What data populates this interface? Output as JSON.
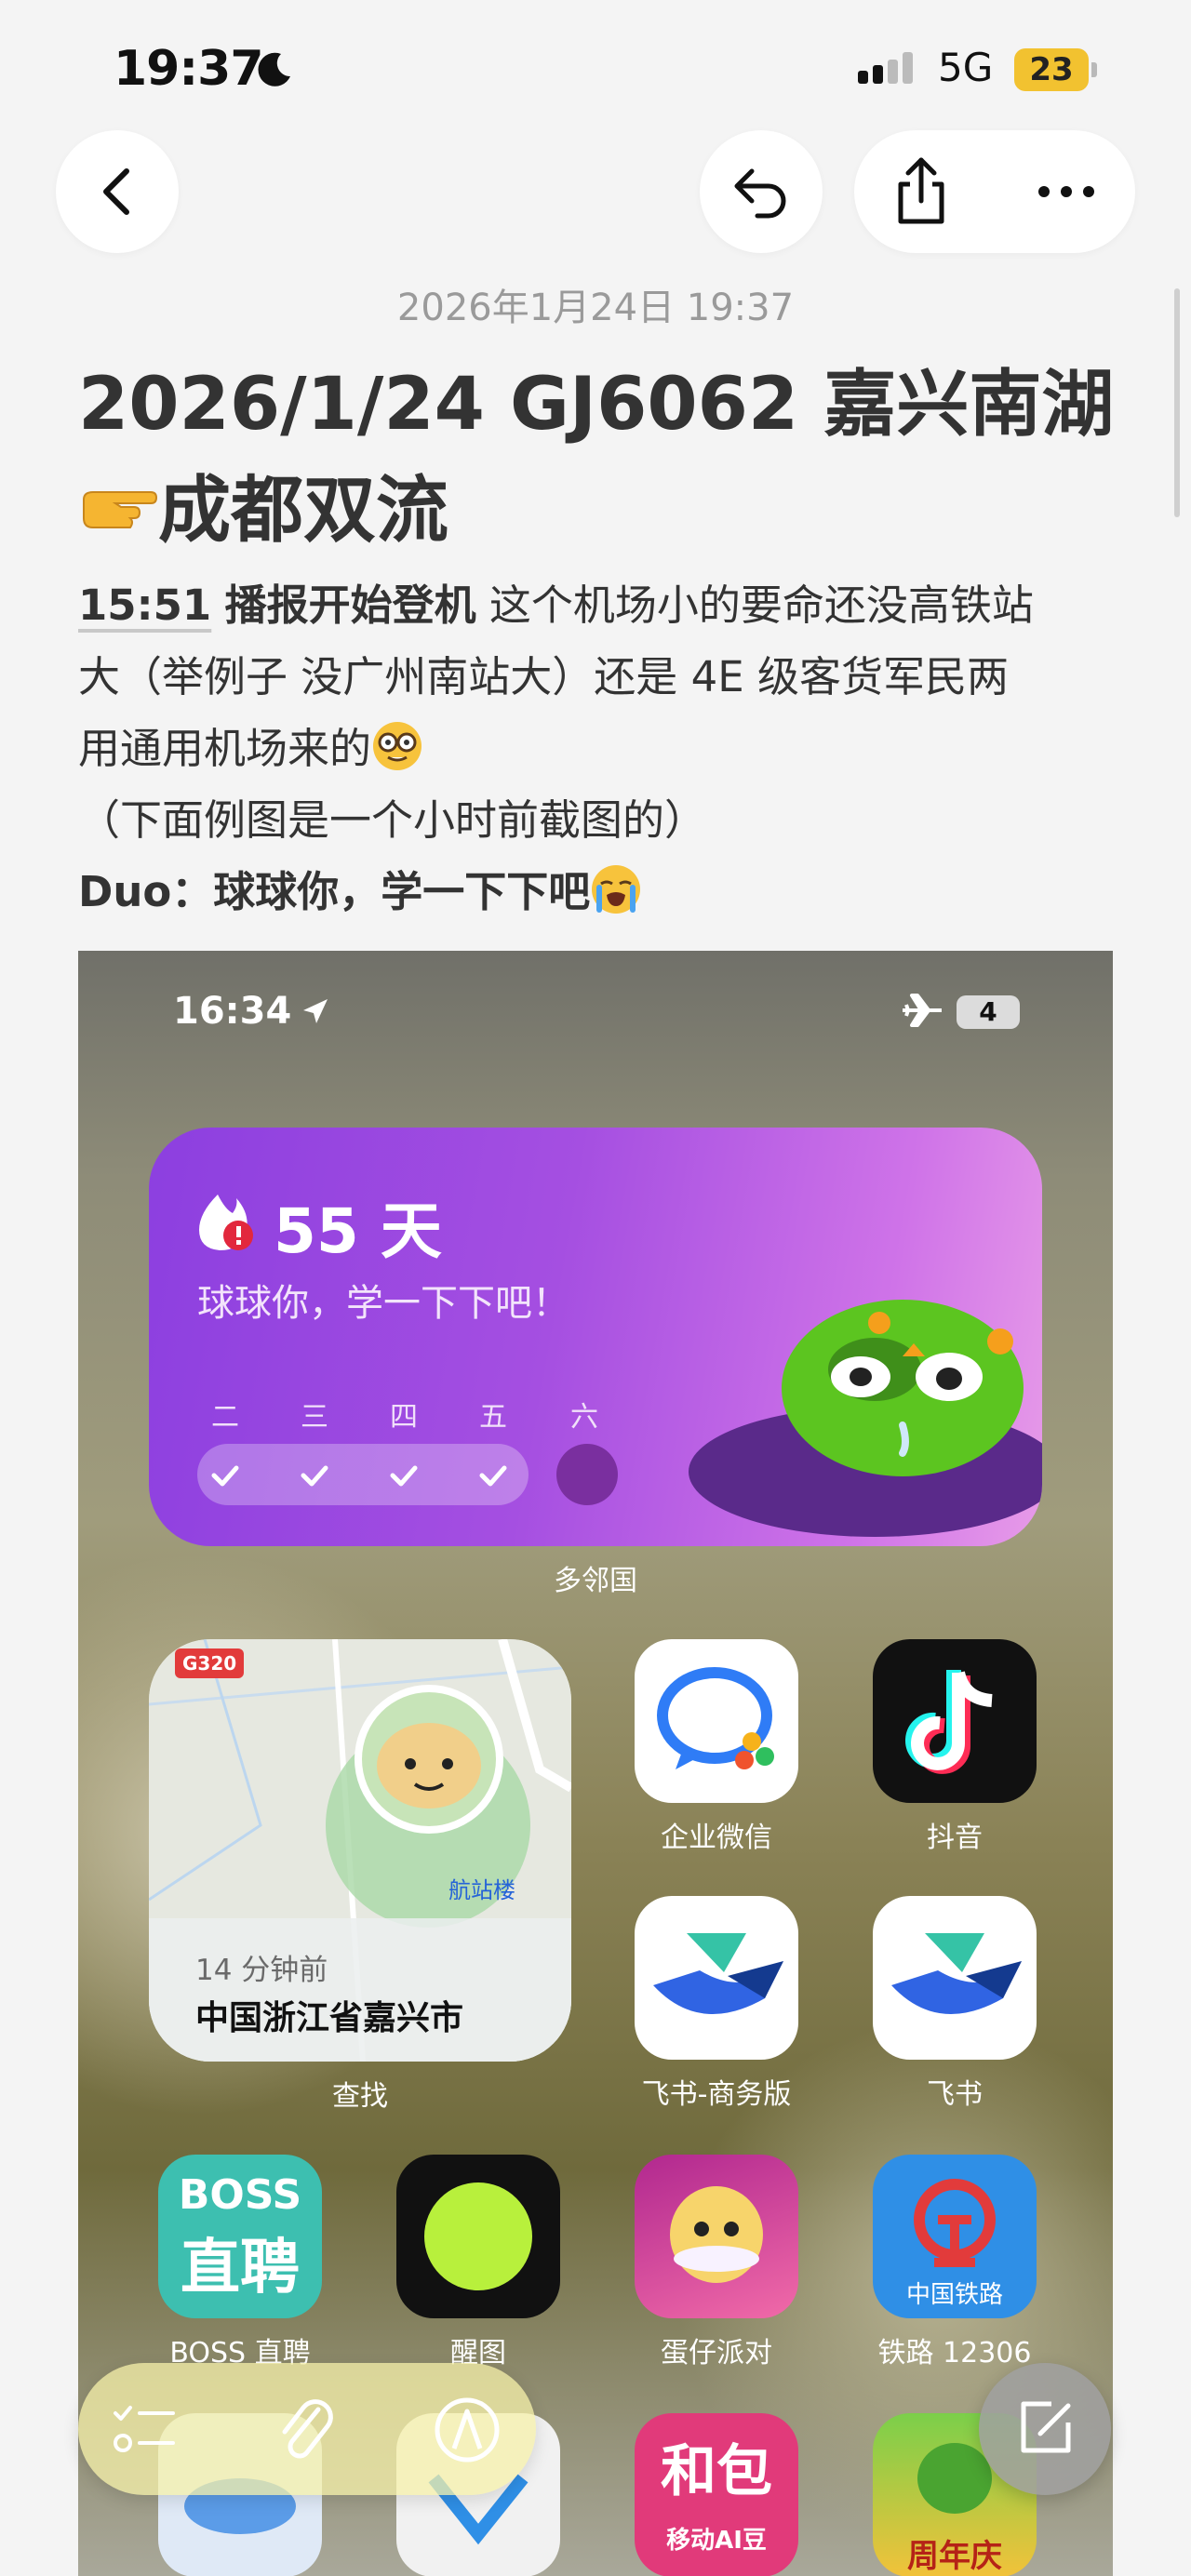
{
  "status_bar": {
    "time": "19:37",
    "network": "5G",
    "battery": "23"
  },
  "post": {
    "date": "2026年1月24日 19:37",
    "title_line1": "2026/1/24 GJ6062 嘉兴南湖",
    "title_line2": "成都双流",
    "body": {
      "time_tag": "15:51",
      "boarding": "播报开始登机",
      "line1_rest": " 这个机场小的要命还没高铁站",
      "line2": "大（举例子 没广州南站大）还是 4E 级客货军民两",
      "line3": "用通用机场来的",
      "line4": "（下面例图是一个小时前截图的）",
      "line5": "Duo：球球你，学一下下吧"
    }
  },
  "embed": {
    "status_time": "16:34",
    "battery": "4",
    "duo_widget": {
      "streak": "55 天",
      "message": "球球你，学一下下吧！",
      "days": [
        "二",
        "三",
        "四",
        "五",
        "六"
      ],
      "label": "多邻国"
    },
    "find_widget": {
      "road_badge": "G320",
      "terminal": "航站楼",
      "time_ago": "14 分钟前",
      "place": "中国浙江省嘉兴市",
      "label": "查找"
    },
    "apps": {
      "wecom": "企业微信",
      "douyin": "抖音",
      "feishu_biz": "飞书-商务版",
      "feishu": "飞书",
      "boss": "BOSS 直聘",
      "boss_icon_top": "BOSS",
      "boss_icon_bottom": "直聘",
      "xingtu": "醒图",
      "eggy": "蛋仔派对",
      "railway": "铁路 12306",
      "railway_icon": "中国铁路",
      "hebao_icon": "和包",
      "hebao_sub": "移动AI豆",
      "anniv": "周年庆"
    }
  },
  "icons": [
    "back-icon",
    "undo-icon",
    "share-icon",
    "more-icon",
    "checklist-icon",
    "attachment-icon",
    "markup-icon",
    "compose-icon"
  ]
}
